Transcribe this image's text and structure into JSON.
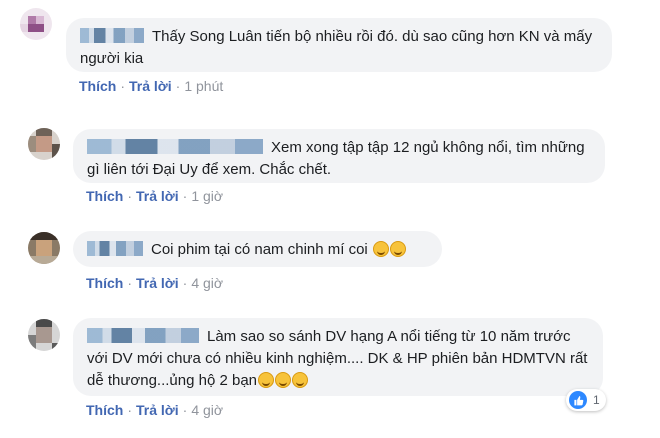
{
  "comments": [
    {
      "text": "Thấy Song Luân tiến bộ nhiều rồi đó. dù sao cũng hơn KN và mấy người kia",
      "actions": {
        "like": "Thích",
        "reply": "Trả lời",
        "time": "1 phút"
      }
    },
    {
      "text": "Xem xong tập tập 12 ngủ không nổi, tìm những gì liên tới Đại Uy để xem. Chắc chết.",
      "actions": {
        "like": "Thích",
        "reply": "Trả lời",
        "time": "1 giờ"
      }
    },
    {
      "text": "Coi phim tại có nam chinh mí coi",
      "actions": {
        "like": "Thích",
        "reply": "Trả lời",
        "time": "4 giờ"
      }
    },
    {
      "text": "Làm sao so sánh DV hạng A nổi tiếng từ 10 năm trước với DV mới chưa có nhiều kinh nghiệm.... DK & HP phiên bản HDMTVN rất dễ thương...ủng hộ 2 bạn",
      "actions": {
        "like": "Thích",
        "reply": "Trả lời",
        "time": "4 giờ"
      },
      "reaction": {
        "icon": "like-icon",
        "count": "1"
      }
    }
  ],
  "separator": "·",
  "colors": {
    "bubble": "#f2f3f5",
    "link": "#4267b2",
    "meta": "#90949c",
    "like_badge": "#2d88ff"
  }
}
